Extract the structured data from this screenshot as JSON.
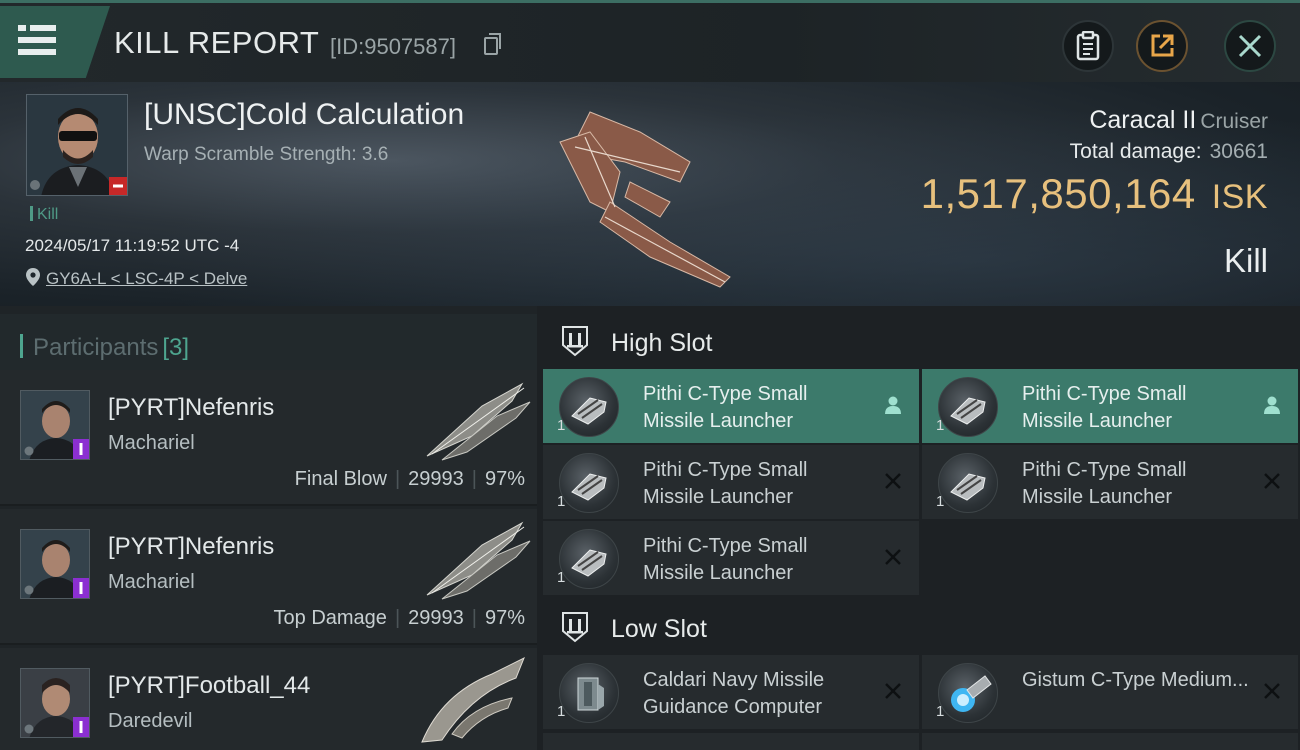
{
  "topbar": {
    "title": "KILL REPORT",
    "report_id": "[ID:9507587]",
    "icons": [
      "menu-icon",
      "copy-icon",
      "clipboard-icon",
      "share-icon",
      "close-icon"
    ]
  },
  "victim": {
    "name": "[UNSC]Cold Calculation",
    "subtitle": "Warp Scramble Strength: 3.6",
    "tag": "Kill",
    "datetime": "2024/05/17 11:19:52 UTC -4",
    "location": "GY6A-L < LSC-4P < Delve",
    "ship_name": "Caracal II",
    "ship_class": "Cruiser",
    "total_damage_label": "Total damage:",
    "total_damage": "30661",
    "isk_value": "1,517,850,164",
    "isk_unit": "ISK",
    "result": "Kill"
  },
  "participants": {
    "label": "Participants",
    "count": "[3]",
    "rows": [
      {
        "name": "[PYRT]Nefenris",
        "ship": "Machariel",
        "role": "Final Blow",
        "damage": "29993",
        "percent": "97%"
      },
      {
        "name": "[PYRT]Nefenris",
        "ship": "Machariel",
        "role": "Top Damage",
        "damage": "29993",
        "percent": "97%"
      },
      {
        "name": "[PYRT]Football_44",
        "ship": "Daredevil",
        "role": "",
        "damage": "",
        "percent": ""
      }
    ]
  },
  "slots": {
    "high": {
      "title": "High Slot",
      "items": [
        {
          "qty": "1",
          "name": "Pithi C-Type Small Missile Launcher",
          "status": "dropped"
        },
        {
          "qty": "1",
          "name": "Pithi C-Type Small Missile Launcher",
          "status": "dropped"
        },
        {
          "qty": "1",
          "name": "Pithi C-Type Small Missile Launcher",
          "status": "destroyed"
        },
        {
          "qty": "1",
          "name": "Pithi C-Type Small Missile Launcher",
          "status": "destroyed"
        },
        {
          "qty": "1",
          "name": "Pithi C-Type Small Missile Launcher",
          "status": "destroyed"
        }
      ]
    },
    "low": {
      "title": "Low Slot",
      "items": [
        {
          "qty": "1",
          "name": "Caldari Navy Missile Guidance Computer",
          "status": "destroyed"
        },
        {
          "qty": "1",
          "name": "Gistum C-Type Medium...",
          "status": "destroyed"
        }
      ]
    }
  },
  "colors": {
    "accent": "#4ea58f",
    "isk": "#e7c07d",
    "selected_row": "#3c7a6b"
  }
}
